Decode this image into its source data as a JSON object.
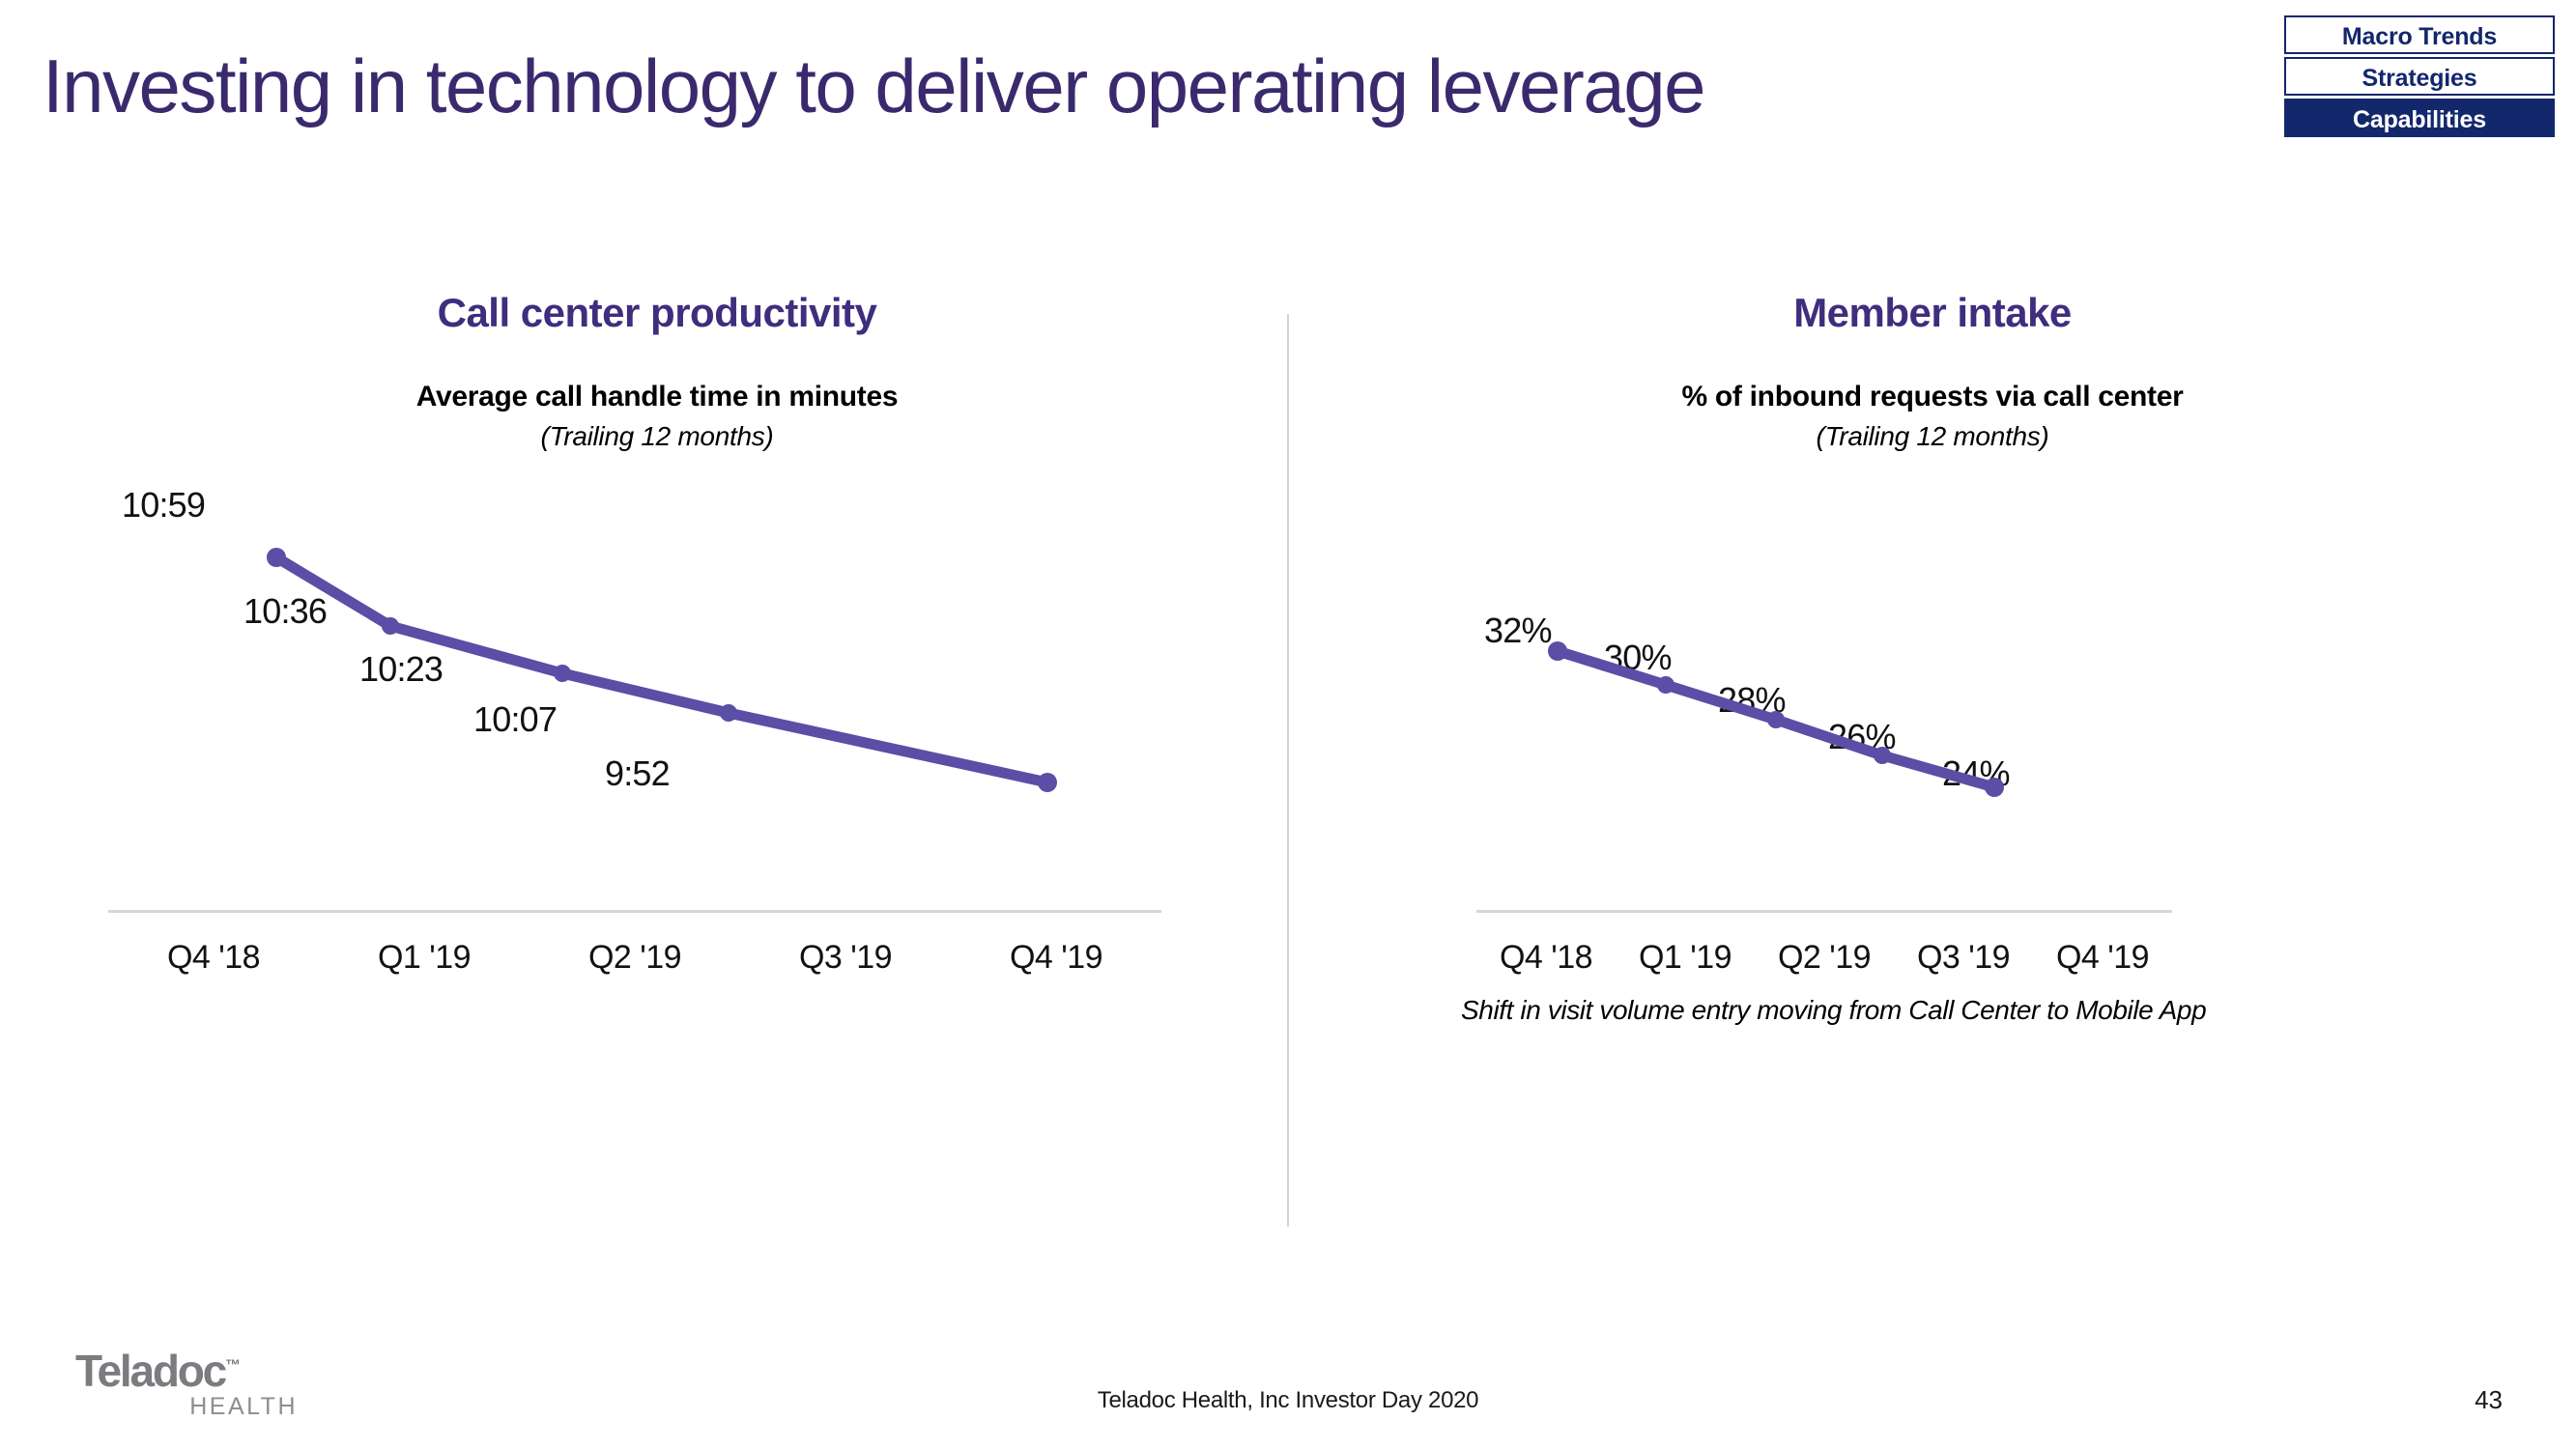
{
  "slide": {
    "title": "Investing in technology to deliver operating leverage",
    "page_number": "43",
    "footer_text": "Teladoc Health, Inc Investor Day 2020",
    "accent_purple": "#5a4ea6",
    "title_purple": "#3a2a6d",
    "heading_purple": "#3f2d7e",
    "navy": "#13276d"
  },
  "nav": {
    "items": [
      {
        "label": "Macro Trends",
        "active": false
      },
      {
        "label": "Strategies",
        "active": false
      },
      {
        "label": "Capabilities",
        "active": true
      }
    ]
  },
  "logo": {
    "word": "Teladoc",
    "tm": "™",
    "sub": "HEALTH"
  },
  "panels": {
    "left": {
      "heading": "Call center productivity",
      "subtitle": "Average call handle time in minutes",
      "subnote": "(Trailing 12 months)",
      "footnote": ""
    },
    "right": {
      "heading": "Member intake",
      "subtitle": "% of inbound requests via call center",
      "subnote": "(Trailing 12 months)",
      "footnote": "Shift in visit volume entry moving from Call Center to Mobile App"
    }
  },
  "chart_data": [
    {
      "type": "line",
      "title": "Call center productivity",
      "subtitle": "Average call handle time in minutes",
      "note": "(Trailing 12 months)",
      "xlabel": "",
      "ylabel": "Average call handle time (minutes)",
      "categories": [
        "Q4 '18",
        "Q1 '19",
        "Q2 '19",
        "Q3 '19",
        "Q4 '19"
      ],
      "point_labels": [
        "10:59",
        "10:36",
        "10:23",
        "10:07",
        "9:52"
      ],
      "values": [
        10.983,
        10.6,
        10.383,
        10.117,
        9.867
      ],
      "ylim": [
        9.6,
        11.2
      ],
      "grid": false,
      "legend": "none",
      "series_color": "#5a4ea6"
    },
    {
      "type": "line",
      "title": "Member intake",
      "subtitle": "% of inbound requests via call center",
      "note": "(Trailing 12 months)",
      "xlabel": "",
      "ylabel": "% of inbound requests via call center",
      "categories": [
        "Q4 '18",
        "Q1 '19",
        "Q2 '19",
        "Q3 '19",
        "Q4 '19"
      ],
      "point_labels": [
        "32%",
        "30%",
        "28%",
        "26%",
        "24%"
      ],
      "values": [
        32,
        30,
        28,
        26,
        24
      ],
      "ylim": [
        22,
        34
      ],
      "grid": false,
      "legend": "none",
      "annotation": "Shift in visit volume entry moving from Call Center to Mobile App",
      "series_color": "#5a4ea6"
    }
  ],
  "left_chart": {
    "tick_labels": [
      "Q4 '18",
      "Q1 '19",
      "Q2 '19",
      "Q3 '19",
      "Q4 '19"
    ],
    "point_labels": [
      "10:59",
      "10:36",
      "10:23",
      "10:07",
      "9:52"
    ]
  },
  "right_chart": {
    "tick_labels": [
      "Q4 '18",
      "Q1 '19",
      "Q2 '19",
      "Q3 '19",
      "Q4 '19"
    ],
    "point_labels": [
      "32%",
      "30%",
      "28%",
      "26%",
      "24%"
    ]
  }
}
